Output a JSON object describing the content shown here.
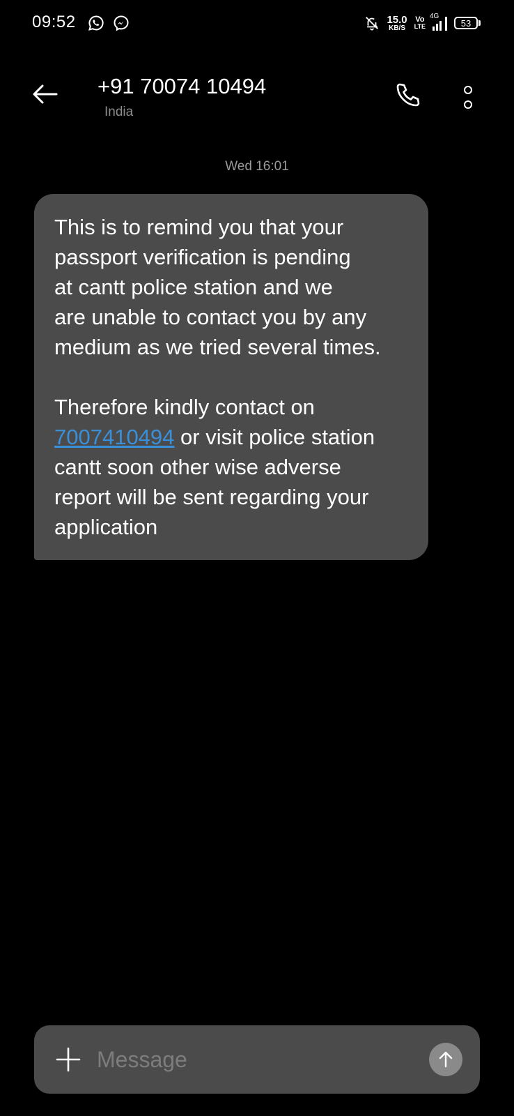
{
  "status_bar": {
    "time": "09:52",
    "net_speed_value": "15.0",
    "net_speed_unit": "KB/S",
    "volte_top": "Vo",
    "volte_bottom": "LTE",
    "network_type": "4G",
    "battery": "53",
    "icons": [
      "whatsapp-icon",
      "messenger-icon",
      "mute-bell-icon",
      "signal-icon",
      "battery-icon"
    ]
  },
  "header": {
    "contact_number": "+91 70074 10494",
    "contact_location": "India",
    "icons": [
      "back-arrow-icon",
      "phone-icon",
      "more-options-icon"
    ]
  },
  "conversation": {
    "timestamp": "Wed 16:01",
    "message": {
      "line1": "This is to remind you that  your",
      "line2": "passport verification  is pending",
      "line3": "at cantt police station and we",
      "line4": "are unable to contact you by any",
      "line5": "medium as we tried several times.",
      "line6_prefix": "Therefore kindly contact  on",
      "link_number": "7007410494",
      "line7_suffix": " or visit police  station",
      "line8": "cantt soon other wise adverse",
      "line9": "report will be sent  regarding your",
      "line10": "application"
    }
  },
  "compose": {
    "placeholder": "Message",
    "value": "",
    "icons": [
      "plus-icon",
      "send-arrow-icon"
    ]
  },
  "colors": {
    "background": "#000000",
    "bubble": "#4b4b4b",
    "link": "#3a8fd9",
    "muted_text": "#9a9a9a",
    "send_button": "#8a8a8a"
  }
}
